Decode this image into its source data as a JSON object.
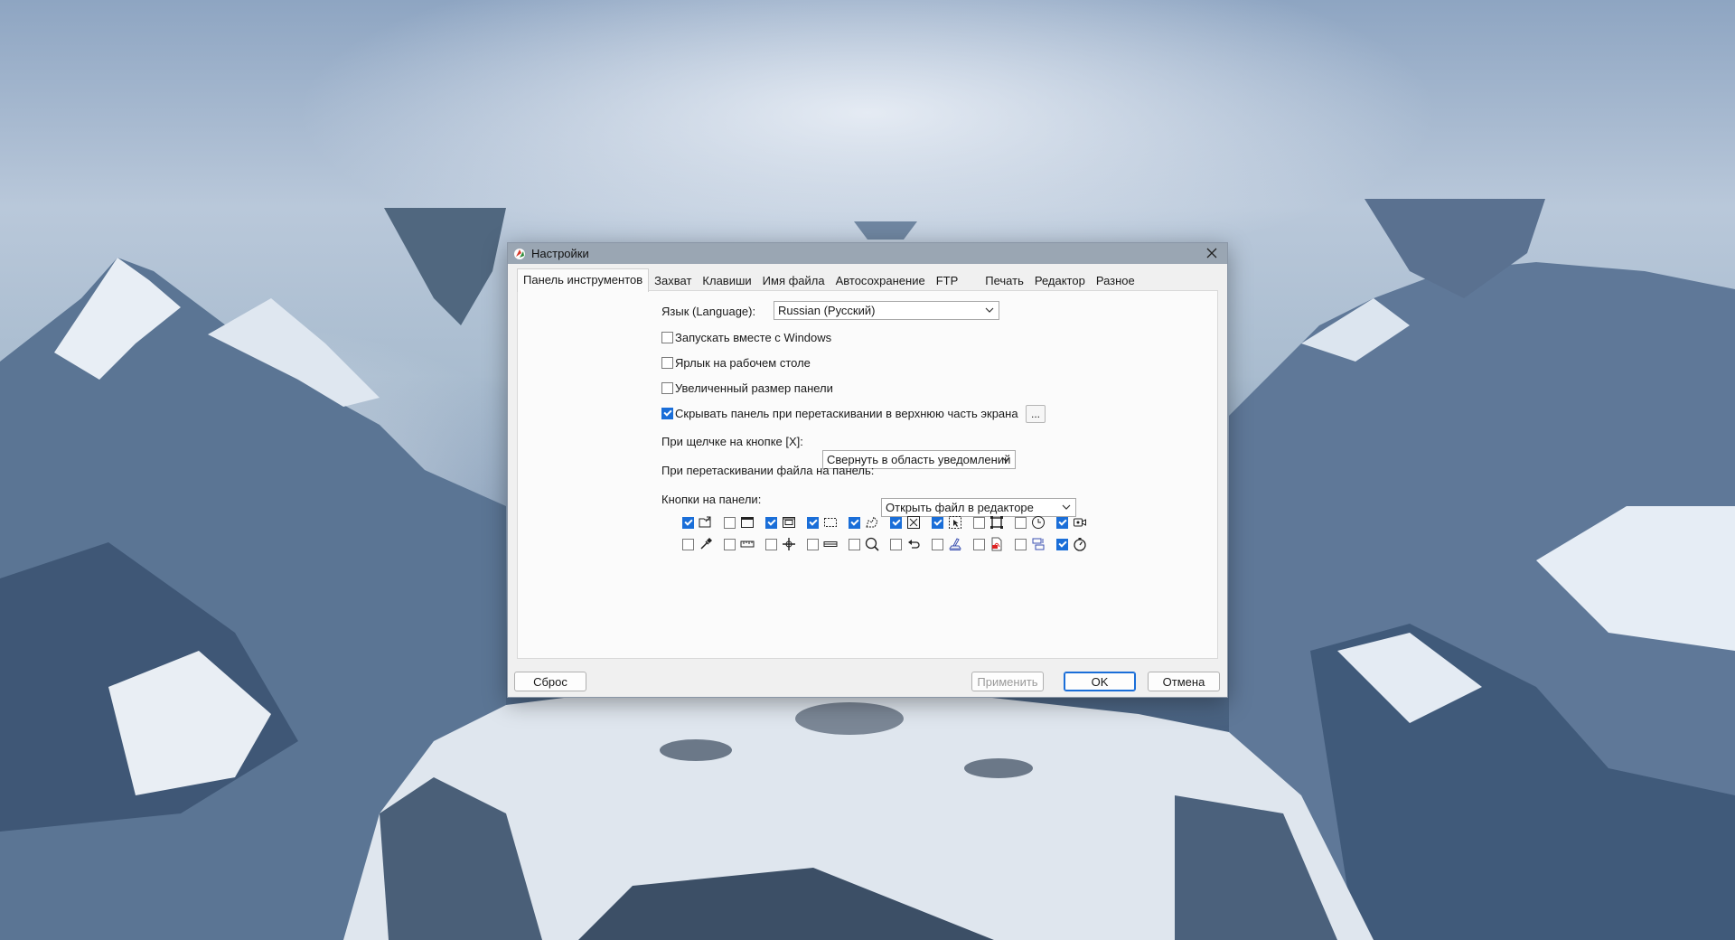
{
  "window": {
    "title": "Настройки",
    "close_icon": "close-icon"
  },
  "tabs": [
    {
      "label": "Панель инструментов",
      "active": true
    },
    {
      "label": "Захват"
    },
    {
      "label": "Клавиши"
    },
    {
      "label": "Имя файла"
    },
    {
      "label": "Автосохранение"
    },
    {
      "label": "FTP"
    },
    {
      "label": "Печать"
    },
    {
      "label": "Редактор"
    },
    {
      "label": "Разное"
    }
  ],
  "toolbar_tab": {
    "language_label": "Язык (Language):",
    "language_value": "Russian (Русский)",
    "checkboxes": [
      {
        "label": "Запускать вместе с Windows",
        "checked": false
      },
      {
        "label": "Ярлык на рабочем столе",
        "checked": false
      },
      {
        "label": "Увеличенный размер панели",
        "checked": false
      },
      {
        "label": "Скрывать панель при перетаскивании в верхнюю часть экрана",
        "checked": true
      }
    ],
    "more_button_label": "...",
    "close_action_label": "При щелчке на кнопке [X]:",
    "close_action_value": "Свернуть в область уведомлений",
    "drop_action_label": "При перетаскивании файла на панель:",
    "drop_action_value": "Открыть файл в редакторе",
    "panel_buttons_label": "Кнопки на панели:",
    "panel_buttons": [
      [
        {
          "icon": "open-folder-icon",
          "checked": true
        },
        {
          "icon": "window-capture-icon",
          "checked": false
        },
        {
          "icon": "scrolling-window-icon",
          "checked": true
        },
        {
          "icon": "rectangle-region-icon",
          "checked": true
        },
        {
          "icon": "freehand-region-icon",
          "checked": true
        },
        {
          "icon": "fullscreen-icon",
          "checked": true
        },
        {
          "icon": "object-capture-icon",
          "checked": true
        },
        {
          "icon": "fixed-region-icon",
          "checked": false
        },
        {
          "icon": "timer-icon",
          "checked": false
        },
        {
          "icon": "video-record-icon",
          "checked": true
        }
      ],
      [
        {
          "icon": "color-picker-icon",
          "checked": false
        },
        {
          "icon": "ruler-icon",
          "checked": false
        },
        {
          "icon": "crosshair-icon",
          "checked": false
        },
        {
          "icon": "protractor-icon",
          "checked": false
        },
        {
          "icon": "magnifier-icon",
          "checked": false
        },
        {
          "icon": "undo-icon",
          "checked": false
        },
        {
          "icon": "scanner-icon",
          "checked": false
        },
        {
          "icon": "pdf-icon",
          "checked": false
        },
        {
          "icon": "compare-icon",
          "checked": false
        },
        {
          "icon": "stopwatch-icon",
          "checked": true
        }
      ]
    ]
  },
  "footer": {
    "reset_label": "Сброс",
    "apply_label": "Применить",
    "ok_label": "OK",
    "cancel_label": "Отмена"
  }
}
